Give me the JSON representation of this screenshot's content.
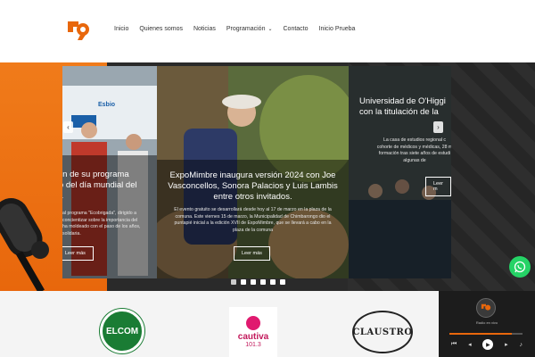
{
  "nav": {
    "items": [
      {
        "label": "Inicio"
      },
      {
        "label": "Quienes somos"
      },
      {
        "label": "Noticias"
      },
      {
        "label": "Programación",
        "has_dropdown": true
      },
      {
        "label": "Contacto"
      },
      {
        "label": "Inicio Prueba"
      }
    ]
  },
  "hero": {
    "slides": [
      {
        "title": "ción de su programa\nrco del día mundial del\nua.",
        "text": "al programa \"Ecobrigada\", dirigido a\nconcientizar sobre la importancia del\nha moldeado con el paso de los años,\nsolidaria.",
        "button": "Leer más",
        "banner_text": "Esbio"
      },
      {
        "title": "ExpoMimbre inaugura versión 2024 con Joe\nVasconcellos, Sonora Palacios y Luis Lambis\nentre otros invitados.",
        "text": "El evento gratuito se desarrollará desde hoy al 17 de marzo en la plaza de la\ncomuna. Este viernes 15 de marzo, la Municipalidad de Chimbarongo dio el\npuntapié inicial a la edición XVII de ExpoMimbre, que se llevará a cabo en la\nplaza de la comuna",
        "button": "Leer más"
      },
      {
        "title": "Universidad de O'Higgi\ncon la titulación de la",
        "text": "La casa de estudios regional c\ncohorte de médicos y médicas, 28 m\nformación tras siete años de estudi\nalgunas de",
        "button": "Leer m"
      }
    ],
    "dots_count": 6,
    "active_dot": 0
  },
  "partners": {
    "elcom": "ELCOM",
    "cautiva_name": "cautiva",
    "cautiva_freq": "101.3",
    "claustro": "CLAUSTRO"
  },
  "player": {
    "caption": "Radio en vivo",
    "progress": 0.85
  },
  "colors": {
    "accent": "#e8670c",
    "whatsapp": "#25d366"
  }
}
